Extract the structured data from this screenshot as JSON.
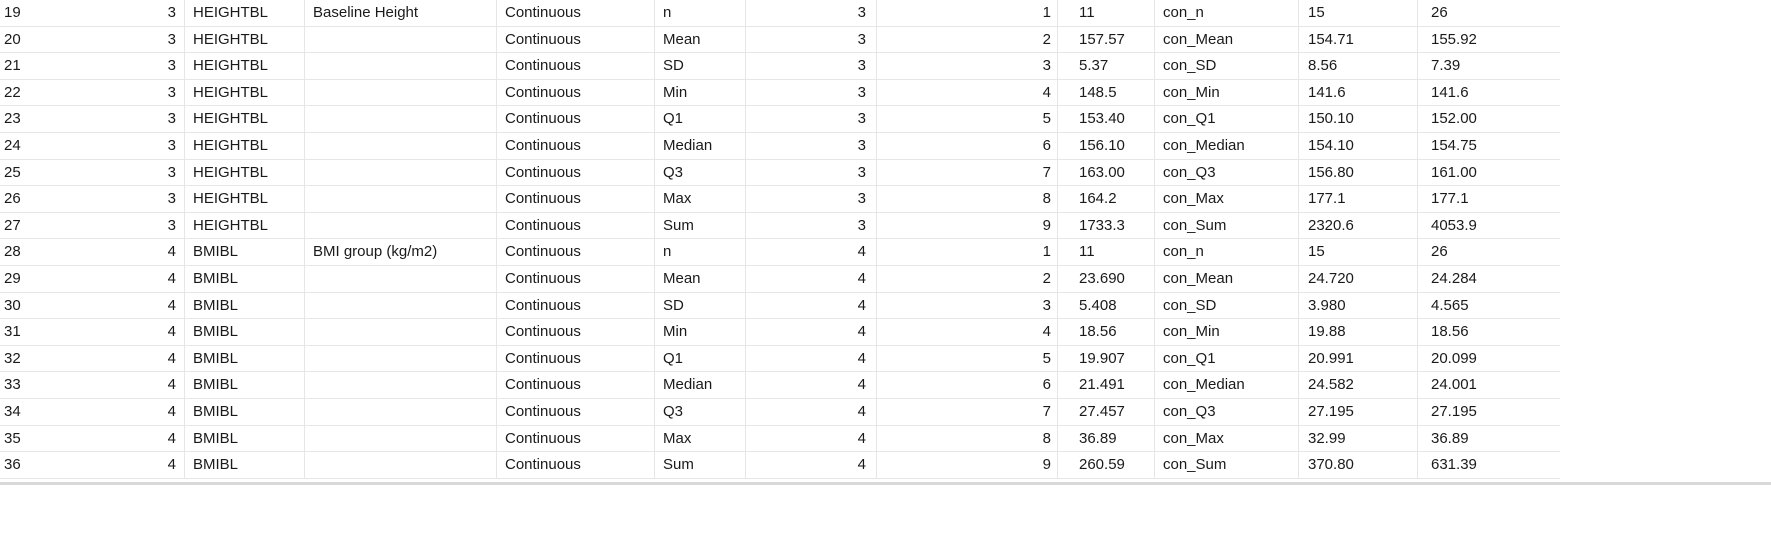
{
  "rows": [
    {
      "rownum": "19",
      "ord": "3",
      "var": "HEIGHTBL",
      "label": "Baseline Height",
      "type": "Continuous",
      "stat": "n",
      "grp": "3",
      "seq": "1",
      "v1": "11",
      "cn": "con_n",
      "v2": "15",
      "v3": "26"
    },
    {
      "rownum": "20",
      "ord": "3",
      "var": "HEIGHTBL",
      "label": "",
      "type": "Continuous",
      "stat": "Mean",
      "grp": "3",
      "seq": "2",
      "v1": "157.57",
      "cn": "con_Mean",
      "v2": "154.71",
      "v3": "155.92"
    },
    {
      "rownum": "21",
      "ord": "3",
      "var": "HEIGHTBL",
      "label": "",
      "type": "Continuous",
      "stat": "SD",
      "grp": "3",
      "seq": "3",
      "v1": "5.37",
      "cn": "con_SD",
      "v2": "8.56",
      "v3": "7.39"
    },
    {
      "rownum": "22",
      "ord": "3",
      "var": "HEIGHTBL",
      "label": "",
      "type": "Continuous",
      "stat": "Min",
      "grp": "3",
      "seq": "4",
      "v1": "148.5",
      "cn": "con_Min",
      "v2": "141.6",
      "v3": "141.6"
    },
    {
      "rownum": "23",
      "ord": "3",
      "var": "HEIGHTBL",
      "label": "",
      "type": "Continuous",
      "stat": "Q1",
      "grp": "3",
      "seq": "5",
      "v1": "153.40",
      "cn": "con_Q1",
      "v2": "150.10",
      "v3": "152.00"
    },
    {
      "rownum": "24",
      "ord": "3",
      "var": "HEIGHTBL",
      "label": "",
      "type": "Continuous",
      "stat": "Median",
      "grp": "3",
      "seq": "6",
      "v1": "156.10",
      "cn": "con_Median",
      "v2": "154.10",
      "v3": "154.75"
    },
    {
      "rownum": "25",
      "ord": "3",
      "var": "HEIGHTBL",
      "label": "",
      "type": "Continuous",
      "stat": "Q3",
      "grp": "3",
      "seq": "7",
      "v1": "163.00",
      "cn": "con_Q3",
      "v2": "156.80",
      "v3": "161.00"
    },
    {
      "rownum": "26",
      "ord": "3",
      "var": "HEIGHTBL",
      "label": "",
      "type": "Continuous",
      "stat": "Max",
      "grp": "3",
      "seq": "8",
      "v1": "164.2",
      "cn": "con_Max",
      "v2": "177.1",
      "v3": "177.1"
    },
    {
      "rownum": "27",
      "ord": "3",
      "var": "HEIGHTBL",
      "label": "",
      "type": "Continuous",
      "stat": "Sum",
      "grp": "3",
      "seq": "9",
      "v1": "1733.3",
      "cn": "con_Sum",
      "v2": "2320.6",
      "v3": "4053.9"
    },
    {
      "rownum": "28",
      "ord": "4",
      "var": "BMIBL",
      "label": "BMI group (kg/m2)",
      "type": "Continuous",
      "stat": "n",
      "grp": "4",
      "seq": "1",
      "v1": "11",
      "cn": "con_n",
      "v2": "15",
      "v3": "26"
    },
    {
      "rownum": "29",
      "ord": "4",
      "var": "BMIBL",
      "label": "",
      "type": "Continuous",
      "stat": "Mean",
      "grp": "4",
      "seq": "2",
      "v1": "23.690",
      "cn": "con_Mean",
      "v2": "24.720",
      "v3": "24.284"
    },
    {
      "rownum": "30",
      "ord": "4",
      "var": "BMIBL",
      "label": "",
      "type": "Continuous",
      "stat": "SD",
      "grp": "4",
      "seq": "3",
      "v1": "5.408",
      "cn": "con_SD",
      "v2": "3.980",
      "v3": "4.565"
    },
    {
      "rownum": "31",
      "ord": "4",
      "var": "BMIBL",
      "label": "",
      "type": "Continuous",
      "stat": "Min",
      "grp": "4",
      "seq": "4",
      "v1": "18.56",
      "cn": "con_Min",
      "v2": "19.88",
      "v3": "18.56"
    },
    {
      "rownum": "32",
      "ord": "4",
      "var": "BMIBL",
      "label": "",
      "type": "Continuous",
      "stat": "Q1",
      "grp": "4",
      "seq": "5",
      "v1": "19.907",
      "cn": "con_Q1",
      "v2": "20.991",
      "v3": "20.099"
    },
    {
      "rownum": "33",
      "ord": "4",
      "var": "BMIBL",
      "label": "",
      "type": "Continuous",
      "stat": "Median",
      "grp": "4",
      "seq": "6",
      "v1": "21.491",
      "cn": "con_Median",
      "v2": "24.582",
      "v3": "24.001"
    },
    {
      "rownum": "34",
      "ord": "4",
      "var": "BMIBL",
      "label": "",
      "type": "Continuous",
      "stat": "Q3",
      "grp": "4",
      "seq": "7",
      "v1": "27.457",
      "cn": "con_Q3",
      "v2": "27.195",
      "v3": "27.195"
    },
    {
      "rownum": "35",
      "ord": "4",
      "var": "BMIBL",
      "label": "",
      "type": "Continuous",
      "stat": "Max",
      "grp": "4",
      "seq": "8",
      "v1": "36.89",
      "cn": "con_Max",
      "v2": "32.99",
      "v3": "36.89"
    },
    {
      "rownum": "36",
      "ord": "4",
      "var": "BMIBL",
      "label": "",
      "type": "Continuous",
      "stat": "Sum",
      "grp": "4",
      "seq": "9",
      "v1": "260.59",
      "cn": "con_Sum",
      "v2": "370.80",
      "v3": "631.39"
    }
  ]
}
